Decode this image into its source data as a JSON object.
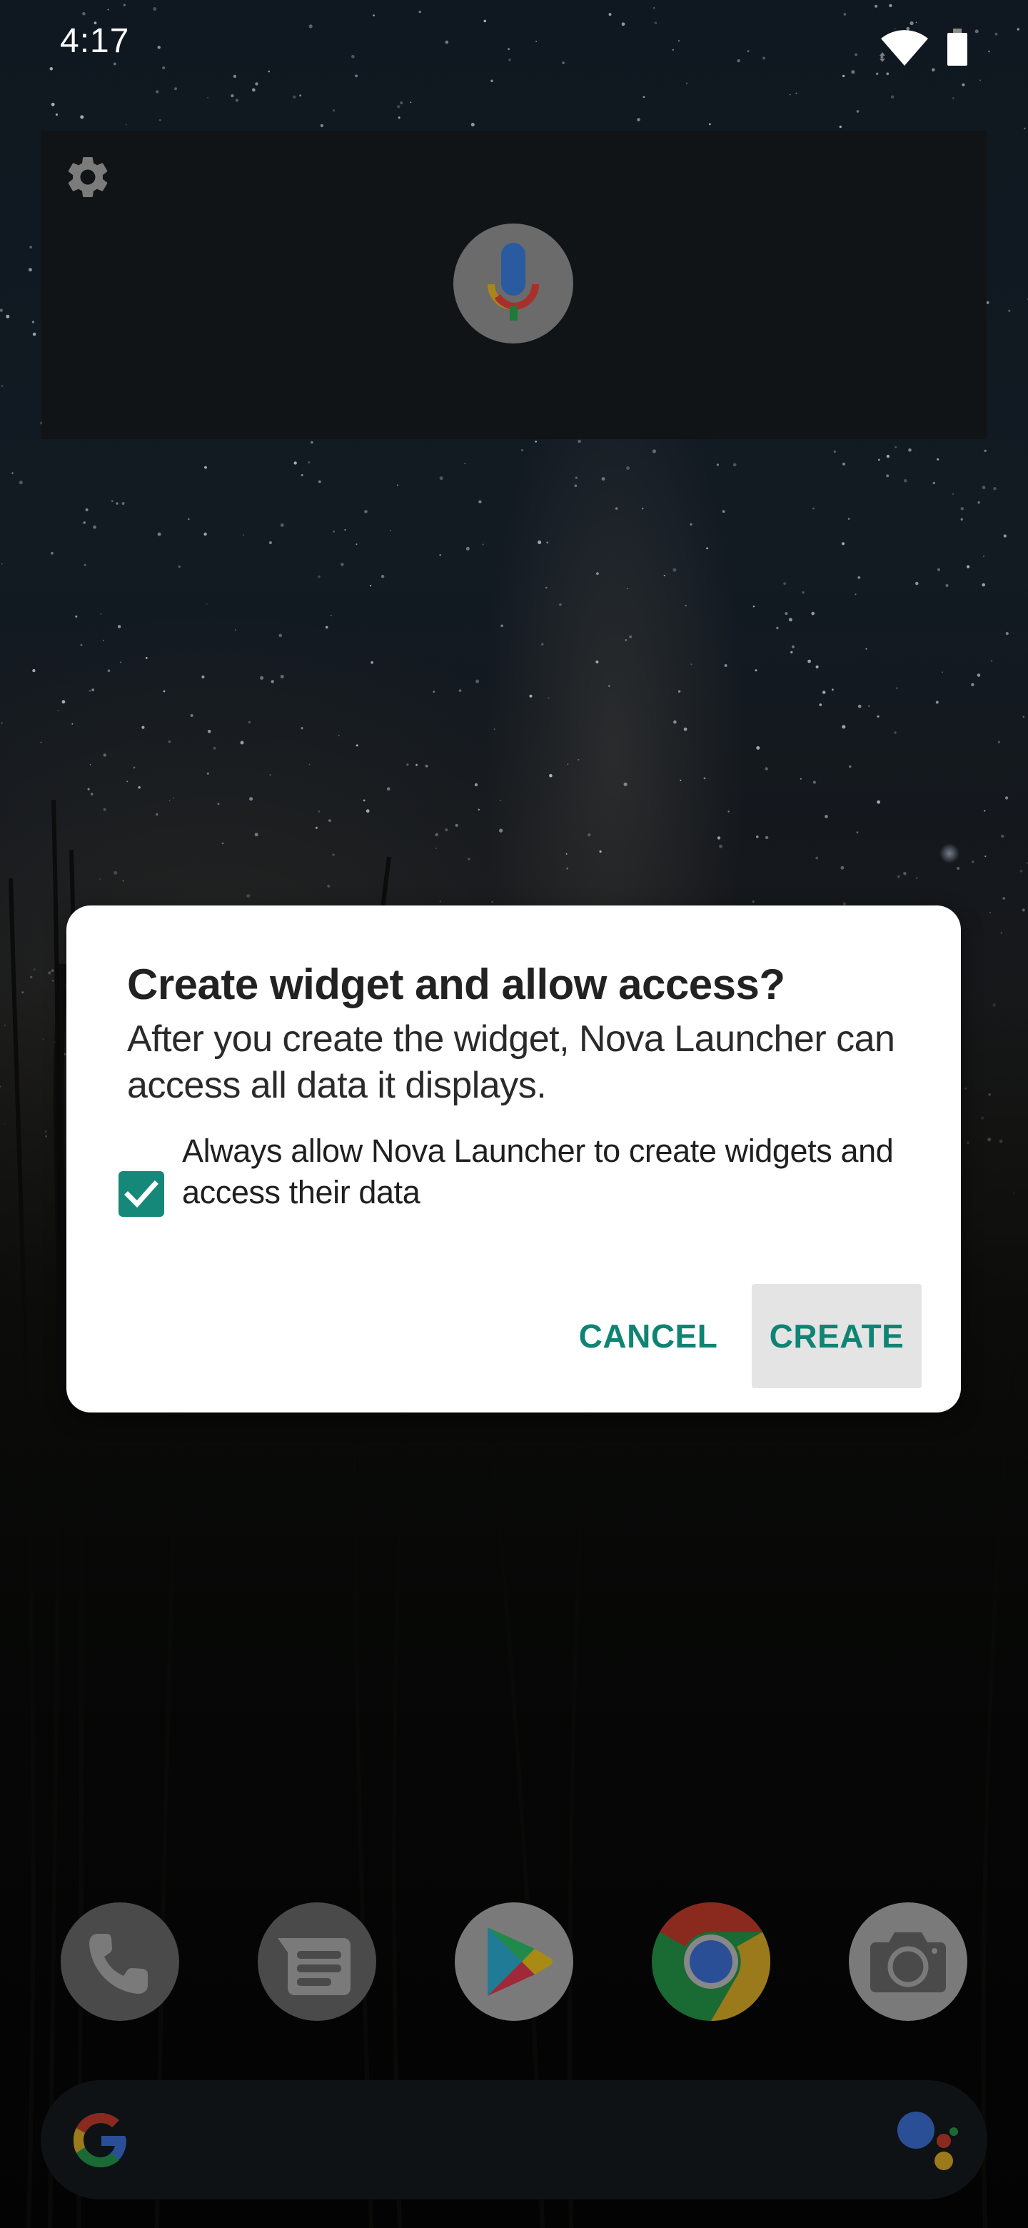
{
  "status_bar": {
    "time": "4:17",
    "icons": [
      "wifi-icon",
      "battery-icon"
    ]
  },
  "widget": {
    "settings_icon": "gear-icon",
    "mic_icon": "google-mic-icon"
  },
  "dialog": {
    "title": "Create widget and allow access?",
    "body": "After you create the widget, Nova Launcher can access all data it displays.",
    "checkbox": {
      "label": "Always allow Nova Launcher to create widgets and access their data",
      "checked": true
    },
    "buttons": {
      "cancel": "CANCEL",
      "create": "CREATE"
    }
  },
  "dock": {
    "apps": [
      {
        "name": "Phone",
        "icon": "phone-icon"
      },
      {
        "name": "Messages",
        "icon": "messages-icon"
      },
      {
        "name": "Play Store",
        "icon": "play-store-icon"
      },
      {
        "name": "Chrome",
        "icon": "chrome-icon"
      },
      {
        "name": "Camera",
        "icon": "camera-icon"
      }
    ]
  },
  "search_bar": {
    "left_icon": "google-g-icon",
    "right_icon": "google-assistant-icon"
  },
  "colors": {
    "accent": "#0f8474",
    "checkbox": "#16887a",
    "dialog_bg": "#ffffff",
    "create_button_bg": "#e4e4e4",
    "widget_bg": "#101416"
  }
}
